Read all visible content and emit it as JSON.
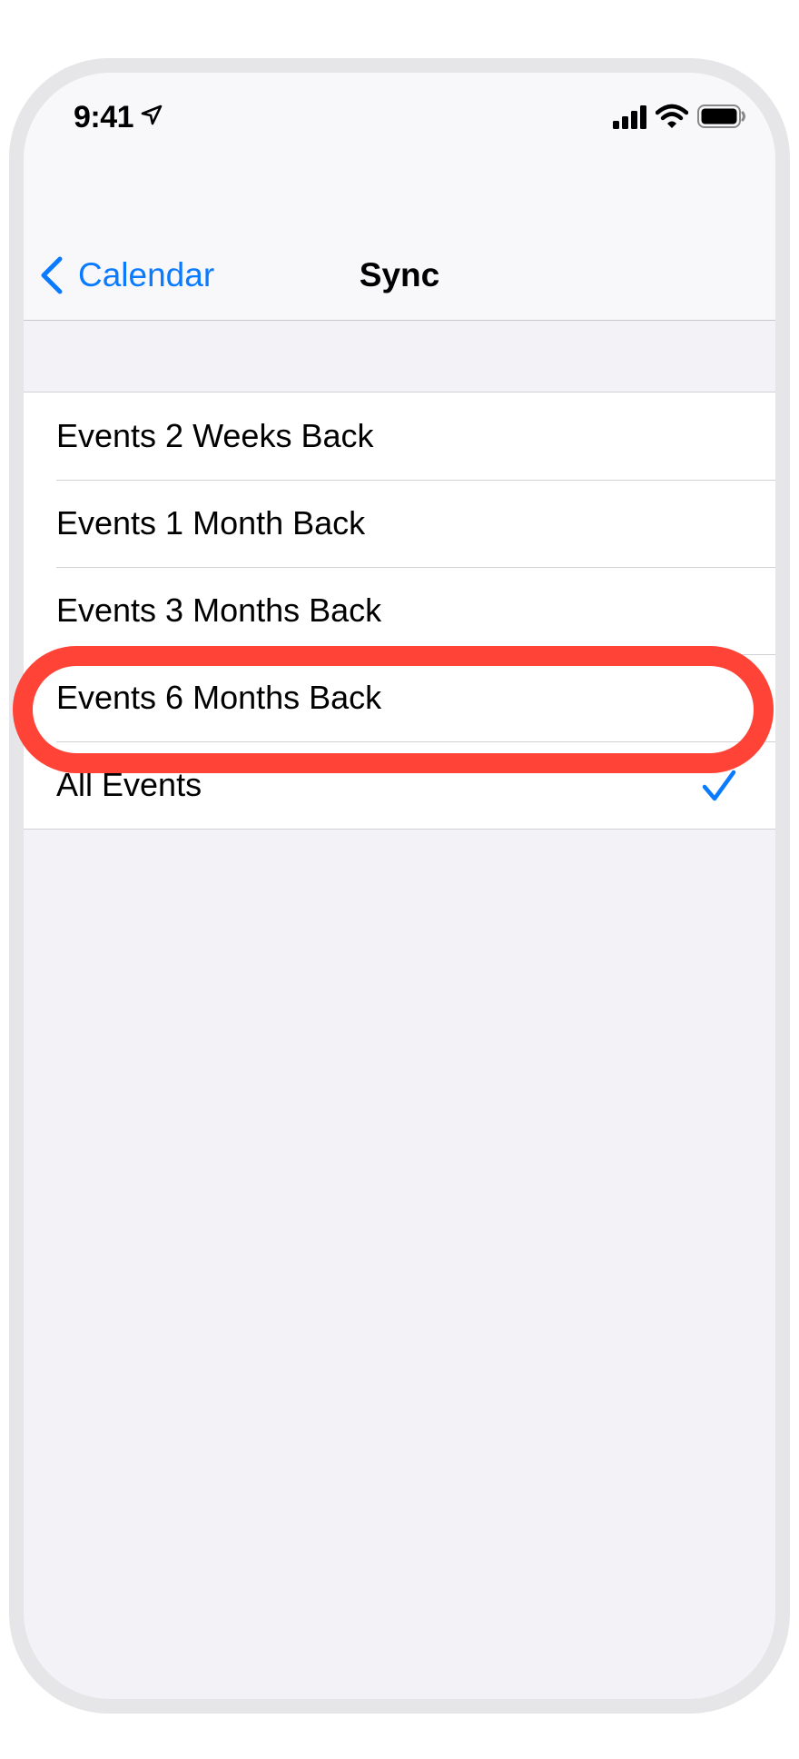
{
  "status_bar": {
    "time": "9:41"
  },
  "nav": {
    "back_label": "Calendar",
    "title": "Sync"
  },
  "sync_options": [
    {
      "label": "Events 2 Weeks Back",
      "selected": false
    },
    {
      "label": "Events 1 Month Back",
      "selected": false
    },
    {
      "label": "Events 3 Months Back",
      "selected": false
    },
    {
      "label": "Events 6 Months Back",
      "selected": false
    },
    {
      "label": "All Events",
      "selected": true
    }
  ],
  "colors": {
    "accent": "#0a7aff",
    "highlight": "#ff4337",
    "background": "#f2f2f7"
  }
}
